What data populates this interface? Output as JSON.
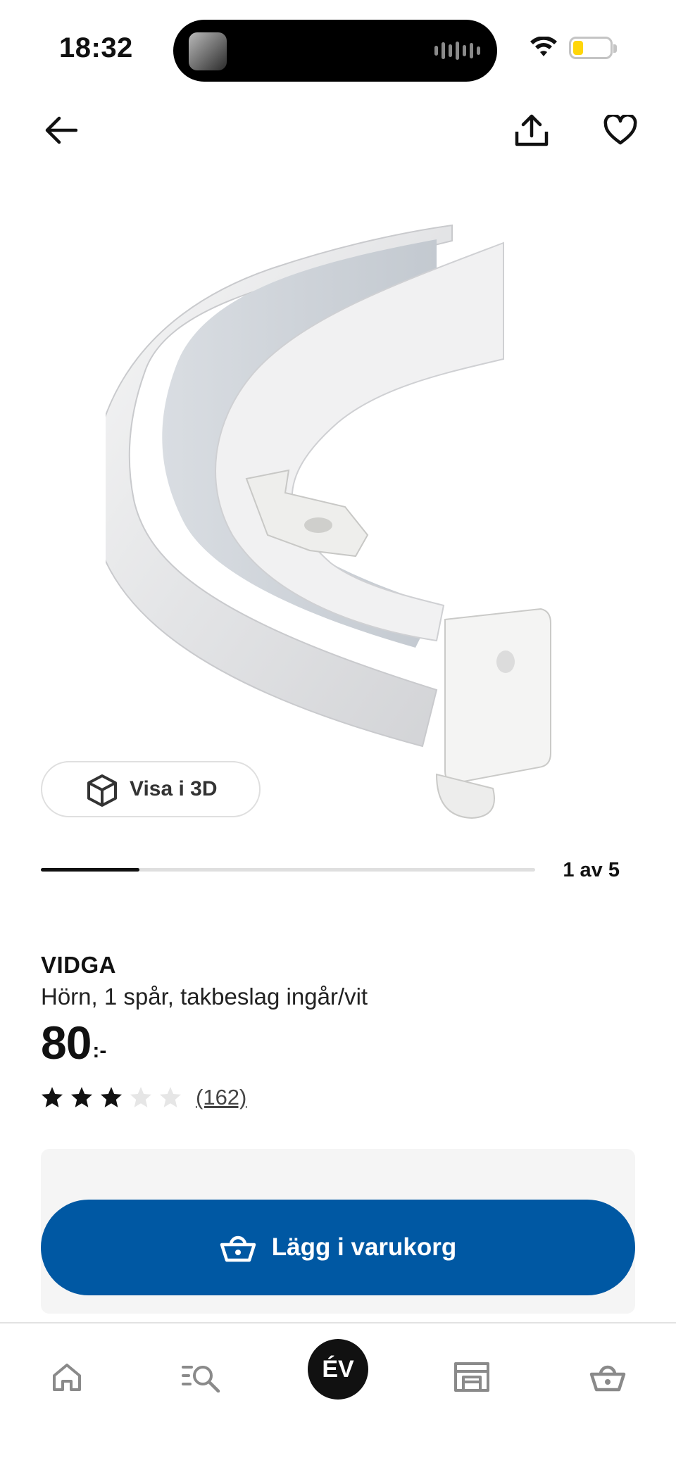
{
  "status_bar": {
    "time": "18:32"
  },
  "icons": {
    "back": "arrow-left-icon",
    "share": "share-icon",
    "favorite": "heart-icon",
    "view3d": "cube-icon",
    "cart": "basket-icon",
    "home": "home-icon",
    "search": "search-list-icon",
    "store": "store-icon"
  },
  "product": {
    "view_3d_label": "Visa i 3D",
    "image_counter": "1 av 5",
    "image_progress": 0.2,
    "brand": "VIDGA",
    "description": "Hörn, 1 spår, takbeslag ingår/vit",
    "price_integer": "80",
    "price_suffix": ":-",
    "rating": 3,
    "rating_max": 5,
    "review_count": "(162)"
  },
  "cart_button": {
    "label": "Lägg i varukorg"
  },
  "tabbar": {
    "profile_initials": "ÉV"
  },
  "colors": {
    "primary_blue": "#0058a3",
    "star_filled": "#111111",
    "star_empty": "#e6e6e6"
  }
}
